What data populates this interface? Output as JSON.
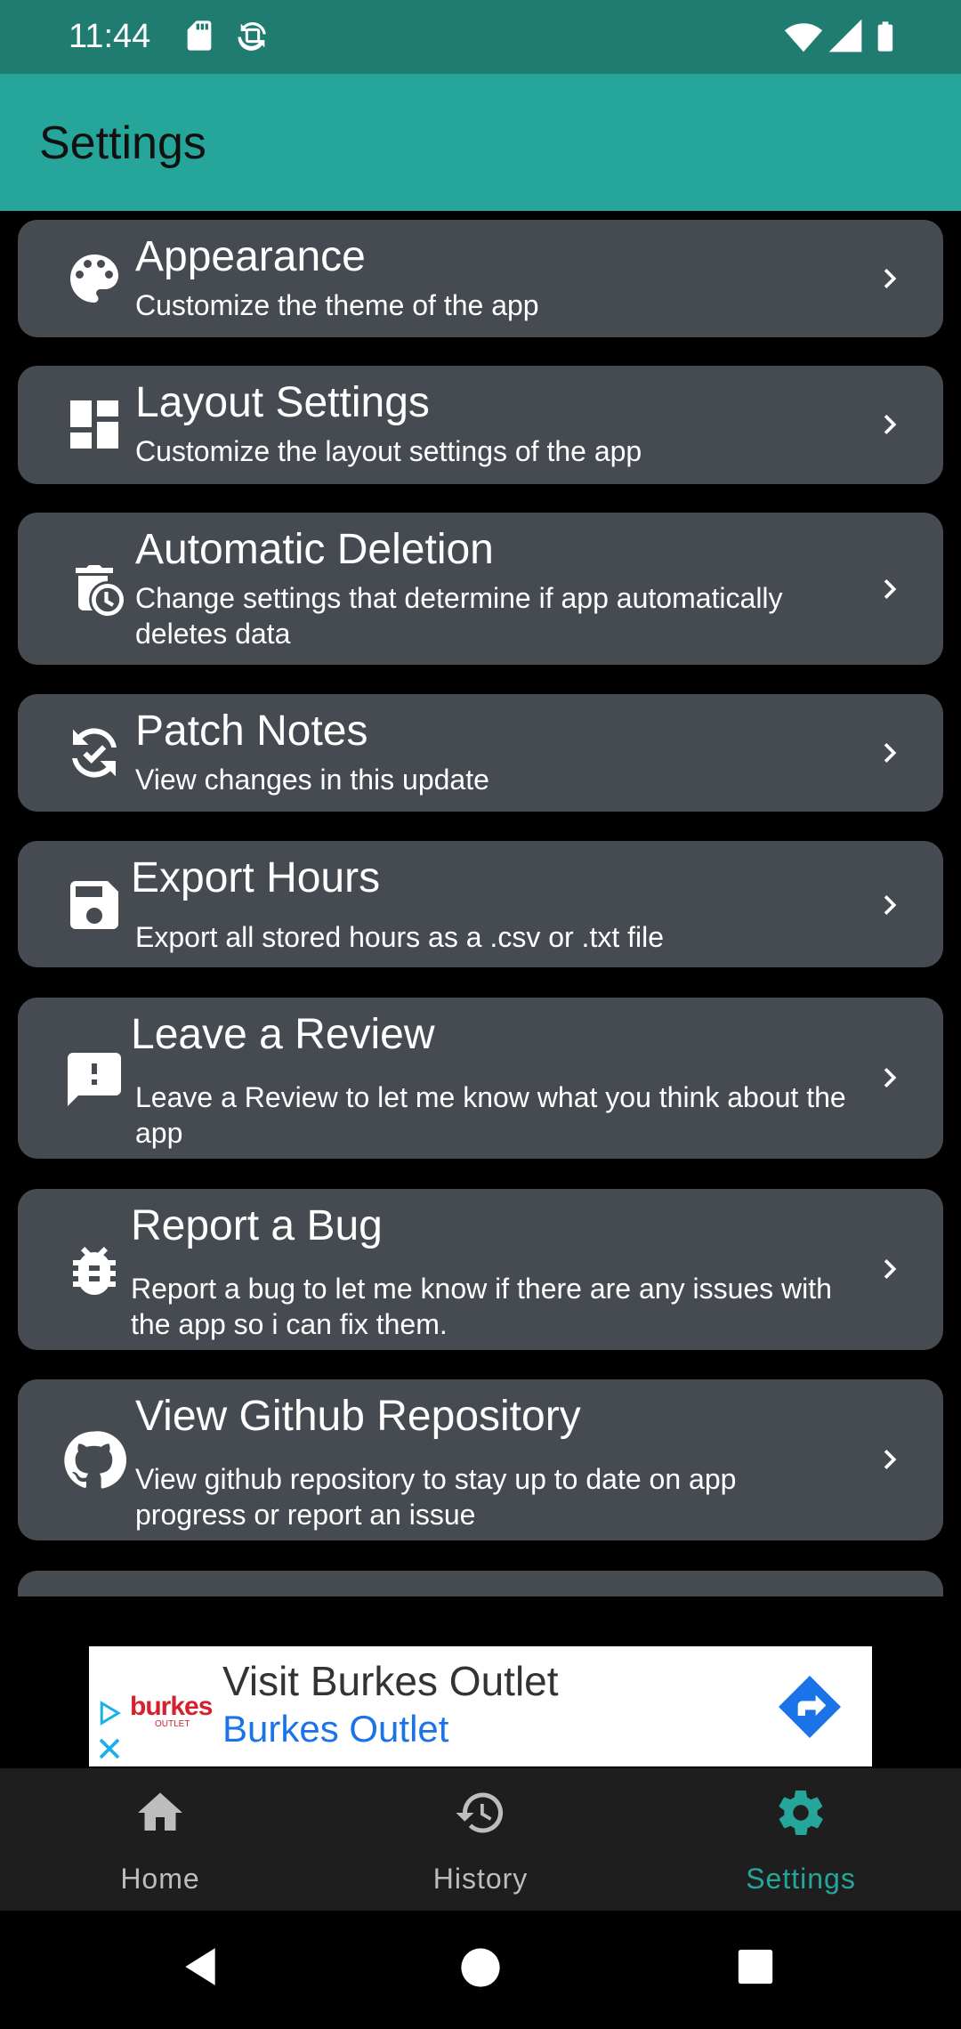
{
  "status_bar": {
    "time": "11:44",
    "left_icons": [
      "sd-card-icon",
      "sync-icon"
    ],
    "right_icons": [
      "wifi-icon",
      "signal-icon",
      "battery-icon"
    ]
  },
  "app_bar": {
    "title": "Settings"
  },
  "settings": [
    {
      "icon": "palette-icon",
      "title": "Appearance",
      "subtitle": "Customize the theme of the app"
    },
    {
      "icon": "dashboard-icon",
      "title": "Layout Settings",
      "subtitle": "Customize the layout settings of the app"
    },
    {
      "icon": "delete-clock-icon",
      "title": "Automatic Deletion",
      "subtitle": "Change settings that determine if app automatically deletes data"
    },
    {
      "icon": "update-icon",
      "title": "Patch Notes",
      "subtitle": "View changes in this update"
    },
    {
      "icon": "save-icon",
      "title": "Export Hours",
      "subtitle": "Export all stored hours as a .csv or .txt file"
    },
    {
      "icon": "feedback-icon",
      "title": "Leave a Review",
      "subtitle": "Leave a Review to let me know what you think about the app"
    },
    {
      "icon": "bug-icon",
      "title": "Report a Bug",
      "subtitle": "Report a bug to let me know if there are any issues with the app so i can fix them."
    },
    {
      "icon": "github-icon",
      "title": "View Github Repository",
      "subtitle": "View github repository to stay up to date on app progress or report an issue"
    }
  ],
  "ad": {
    "title": "Visit Burkes Outlet",
    "subtitle": "Burkes Outlet",
    "logo_text": "burkes",
    "logo_subtext": "OUTLET"
  },
  "bottom_nav": [
    {
      "icon": "home-icon",
      "label": "Home",
      "active": false
    },
    {
      "icon": "history-icon",
      "label": "History",
      "active": false
    },
    {
      "icon": "gear-icon",
      "label": "Settings",
      "active": true
    }
  ],
  "colors": {
    "accent": "#26a69a",
    "status_bar": "#207c71",
    "card": "#464b52",
    "active_nav": "#26a69a"
  }
}
